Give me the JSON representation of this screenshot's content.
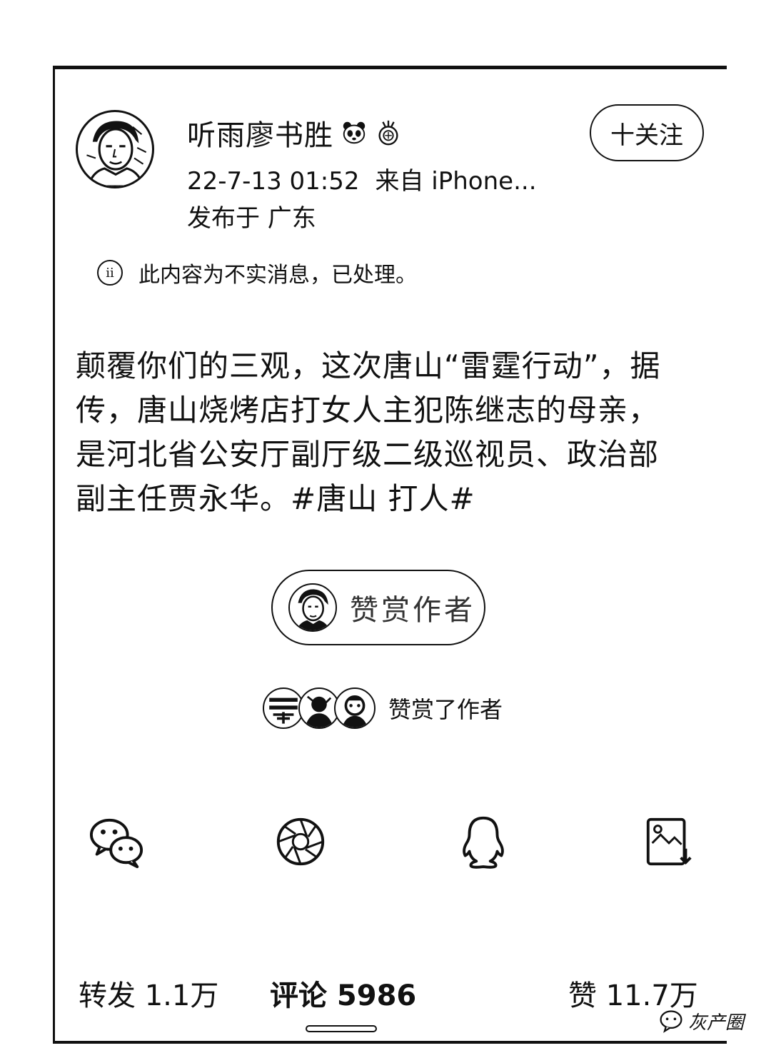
{
  "post": {
    "author_name": "听雨廖书胜",
    "timestamp": "22-7-13 01:52",
    "source": "来自 iPhone...",
    "location": "发布于 广东",
    "follow_label": "十关注",
    "notice": {
      "icon": "info-icon",
      "icon_glyph": "ii",
      "text": "此内容为不实消息，已处理。"
    },
    "body_lines": [
      "颠覆你们的三观，这次唐山“雷霆行动”，据",
      "传，唐山烧烤店打女人主犯陈继志的母亲，",
      "是河北省公安厅副厅级二级巡视员、政治部",
      "副主任贾永华。#唐山 打人#"
    ],
    "reward_label": "赞赏作者",
    "rewarders_text": "赞赏了作者"
  },
  "share": [
    {
      "name": "wechat-icon"
    },
    {
      "name": "moments-icon"
    },
    {
      "name": "qq-icon"
    },
    {
      "name": "save-image-icon"
    }
  ],
  "stats": {
    "repost": "转发 1.1万",
    "comments": "评论 5986",
    "likes": "赞 11.7万"
  },
  "watermark": {
    "text": "灰产圈"
  }
}
